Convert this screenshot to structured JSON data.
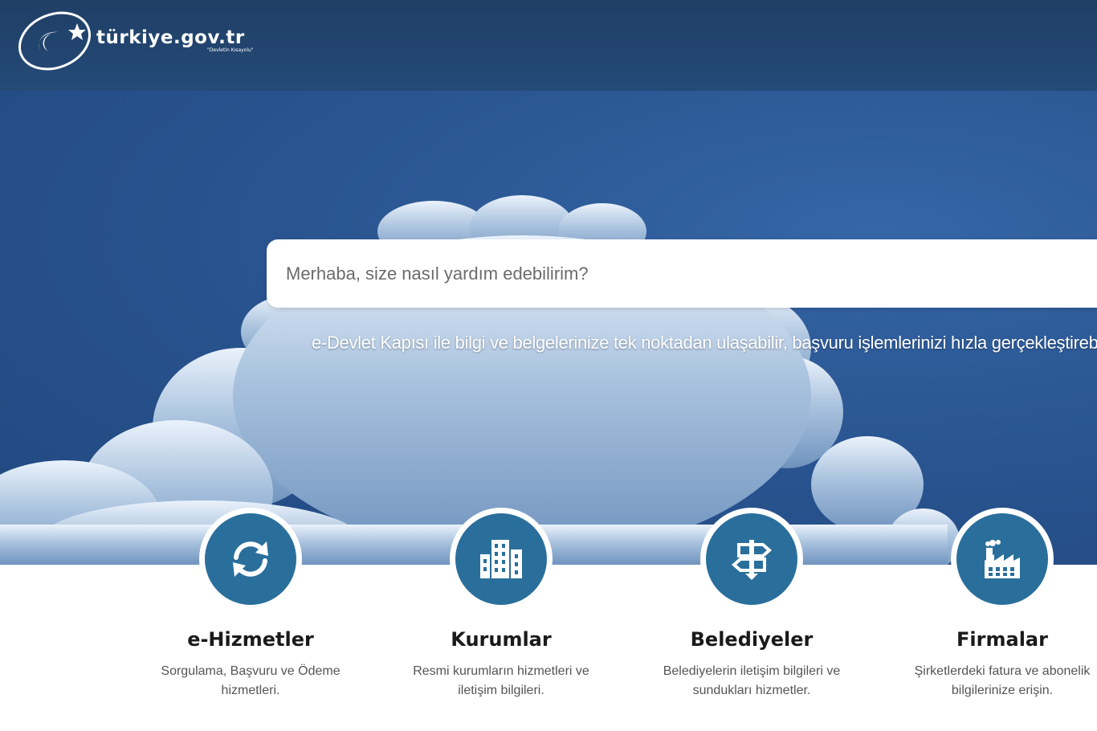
{
  "header": {
    "logo_text": "türkiye.gov.tr",
    "logo_tagline": "\"Devletin Kısayolu\""
  },
  "search": {
    "placeholder": "Merhaba, size nasıl yardım edebilirim?"
  },
  "hero": {
    "subtitle": "e-Devlet Kapısı ile bilgi ve belgelerinize tek noktadan ulaşabilir, başvuru işlemlerinizi hızla gerçekleştirebilirsiniz."
  },
  "categories": [
    {
      "title": "e-Hizmetler",
      "description": "Sorgulama, Başvuru ve Ödeme hizmetleri.",
      "icon": "refresh-icon"
    },
    {
      "title": "Kurumlar",
      "description": "Resmi kurumların hizmetleri ve iletişim bilgileri.",
      "icon": "building-icon"
    },
    {
      "title": "Belediyeler",
      "description": "Belediyelerin iletişim bilgileri ve sundukları hizmetler.",
      "icon": "signpost-icon"
    },
    {
      "title": "Firmalar",
      "description": "Şirketlerdeki fatura ve abonelik bilgilerinize erişin.",
      "icon": "factory-icon"
    }
  ],
  "colors": {
    "header_bg": "#1f3f66",
    "sky": "#2a5591",
    "icon_circle": "#2a6f9b"
  }
}
